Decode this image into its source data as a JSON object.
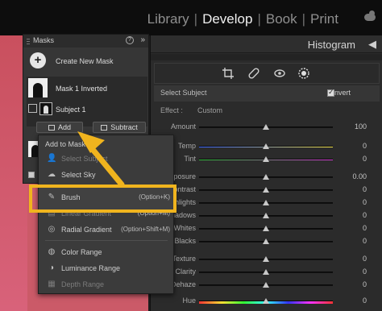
{
  "nav": {
    "modules": [
      {
        "label": "Library",
        "active": false
      },
      {
        "label": "Develop",
        "active": true
      },
      {
        "label": "Book",
        "active": false
      },
      {
        "label": "Print",
        "active": false
      }
    ],
    "separator": "|",
    "cloud_icon": "cloud-sync-icon"
  },
  "right_panel": {
    "histogram_title": "Histogram",
    "histogram_arrow": "◀",
    "tools": [
      "crop-icon",
      "healing-icon",
      "red-eye-icon",
      "masking-icon"
    ],
    "mask_type": "Select Subject",
    "invert_label": "Invert",
    "invert_checked": true,
    "effect_label": "Effect :",
    "effect_value": "Custom",
    "sliders": [
      {
        "label": "Amount",
        "value": "100",
        "pos": 0.5
      },
      {
        "label": "Temp",
        "value": "0",
        "pos": 0.5
      },
      {
        "label": "Tint",
        "value": "0",
        "pos": 0.5
      },
      {
        "label": "Exposure",
        "value": "0.00",
        "pos": 0.5
      },
      {
        "label": "Contrast",
        "value": "0",
        "pos": 0.5
      },
      {
        "label": "Highlights",
        "value": "0",
        "pos": 0.5
      },
      {
        "label": "Shadows",
        "value": "0",
        "pos": 0.5
      },
      {
        "label": "Whites",
        "value": "0",
        "pos": 0.5
      },
      {
        "label": "Blacks",
        "value": "0",
        "pos": 0.5
      },
      {
        "label": "Texture",
        "value": "0",
        "pos": 0.5
      },
      {
        "label": "Clarity",
        "value": "0",
        "pos": 0.5
      },
      {
        "label": "Dehaze",
        "value": "0",
        "pos": 0.5
      },
      {
        "label": "Hue",
        "value": "0",
        "pos": 0.5
      }
    ]
  },
  "masks_panel": {
    "title": "Masks",
    "help": "?",
    "collapse": "»",
    "create_label": "Create New Mask",
    "mask1_label": "Mask 1 Inverted",
    "subject_label": "Subject 1",
    "add_label": "Add",
    "subtract_label": "Subtract",
    "show_label": "S"
  },
  "add_menu": {
    "title": "Add to Mask",
    "items": [
      {
        "label": "Select Subject",
        "shortcut": "",
        "icon": "select-subject-icon",
        "dim": true
      },
      {
        "label": "Select Sky",
        "shortcut": "",
        "icon": "select-sky-icon",
        "dim": false
      },
      {
        "label": "Brush",
        "shortcut": "(Option+K)",
        "icon": "brush-icon",
        "dim": false
      },
      {
        "label": "Linear Gradient",
        "shortcut": "(Option+M)",
        "icon": "linear-gradient-icon",
        "dim": true
      },
      {
        "label": "Radial Gradient",
        "shortcut": "(Option+Shift+M)",
        "icon": "radial-gradient-icon",
        "dim": false
      },
      {
        "label": "Color Range",
        "shortcut": "",
        "icon": "color-range-icon",
        "dim": false
      },
      {
        "label": "Luminance Range",
        "shortcut": "",
        "icon": "luminance-range-icon",
        "dim": false
      },
      {
        "label": "Depth Range",
        "shortcut": "",
        "icon": "depth-range-icon",
        "dim": true
      }
    ]
  },
  "colors": {
    "highlight": "#f0b41e",
    "temp_gradient": [
      "#3b66ff",
      "#f3e24a"
    ],
    "tint_gradient": [
      "#2fbf3a",
      "#d33ad3"
    ]
  }
}
